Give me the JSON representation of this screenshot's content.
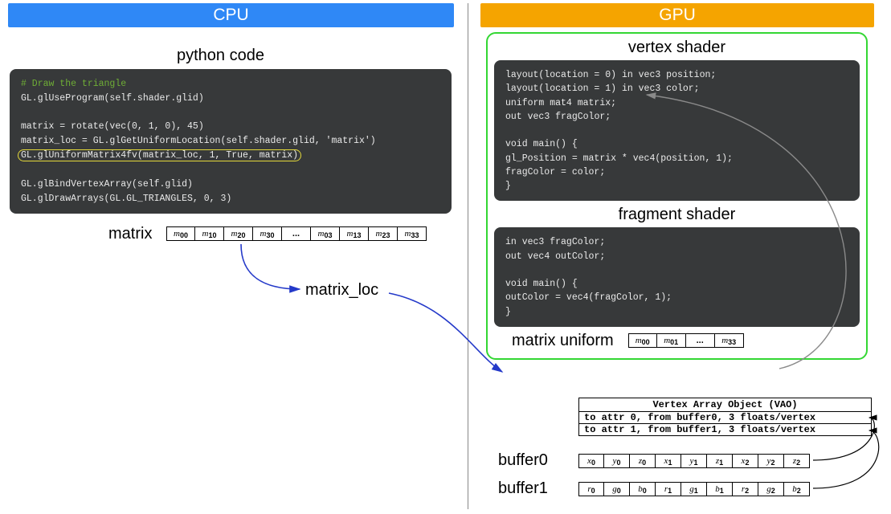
{
  "cpu": {
    "banner": "CPU",
    "section_title": "python code"
  },
  "gpu": {
    "banner": "GPU",
    "vertex_title": "vertex shader",
    "fragment_title": "fragment shader"
  },
  "py": {
    "comment": "# Draw the triangle",
    "l1": "GL.glUseProgram(self.shader.glid)",
    "l2": "matrix = rotate(vec(0, 1, 0), 45)",
    "l3": "matrix_loc = GL.glGetUniformLocation(self.shader.glid, 'matrix')",
    "l4": "GL.glUniformMatrix4fv(matrix_loc, 1, True, matrix)",
    "l5": "GL.glBindVertexArray(self.glid)",
    "l6": "GL.glDrawArrays(GL.GL_TRIANGLES, 0, 3)"
  },
  "vs": {
    "l1a": "layout(location = 0) ",
    "l1b": "in",
    "l1c": " vec3",
    "l1d": " position;",
    "l2a": "layout(location = 1) ",
    "l2b": "in",
    "l2c": " vec3",
    "l2d": " color;",
    "l3a": "uniform",
    "l3b": " mat4",
    "l3c": " matrix;",
    "l4a": "out",
    "l4b": " vec3",
    "l4c": " fragColor;",
    "l5a": "void",
    "l5b": " main() {",
    "l6a": "    gl_Position = matrix * ",
    "l6b": "vec4",
    "l6c": "(position, 1);",
    "l7": "    fragColor = color;",
    "l8": "}"
  },
  "fs": {
    "l1a": "in",
    "l1b": " vec3",
    "l1c": " fragColor;",
    "l2a": "out",
    "l2b": " vec4",
    "l2c": " outColor;",
    "l3a": "void",
    "l3b": " main() {",
    "l4a": "    outColor = ",
    "l4b": "vec4",
    "l4c": "(fragColor, 1);",
    "l5": "}"
  },
  "labels": {
    "matrix": "matrix",
    "matrix_loc": "matrix_loc",
    "matrix_uniform": "matrix uniform",
    "buffer0": "buffer0",
    "buffer1": "buffer1"
  },
  "matrix_cells": [
    "m00",
    "m10",
    "m20",
    "m30",
    "...",
    "m03",
    "m13",
    "m23",
    "m33"
  ],
  "uniform_cells": [
    "m00",
    "m01",
    "...",
    "m33"
  ],
  "vao": {
    "title": "Vertex Array Object (VAO)",
    "row0": "to attr 0, from buffer0, 3 floats/vertex",
    "row1": "to attr 1, from buffer1, 3 floats/vertex"
  },
  "buffer0_cells": [
    "x0",
    "y0",
    "z0",
    "x1",
    "y1",
    "z1",
    "x2",
    "y2",
    "z2"
  ],
  "buffer1_cells": [
    "r0",
    "g0",
    "b0",
    "r1",
    "g1",
    "b1",
    "r2",
    "g2",
    "b2"
  ]
}
